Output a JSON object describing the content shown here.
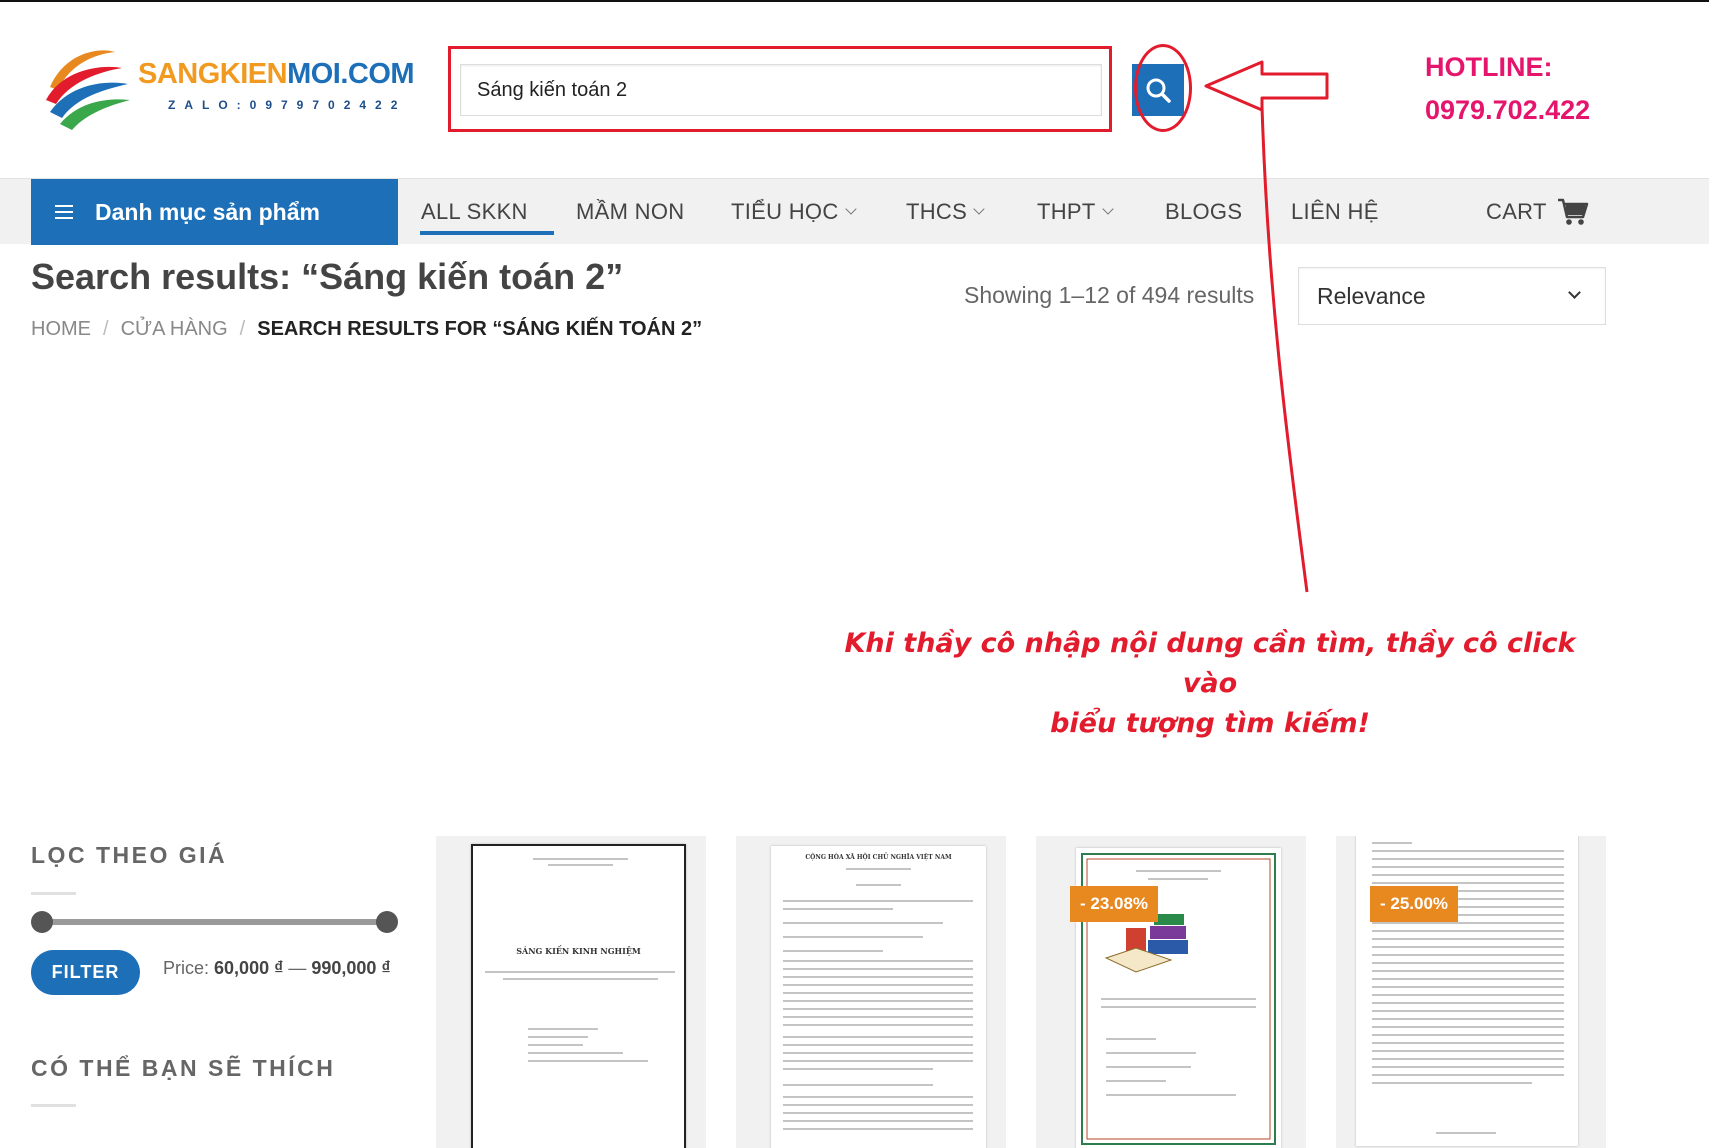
{
  "header": {
    "logo": {
      "word1": "SANGKIEN",
      "word2": "MOI.COM",
      "zalo": "ZALO:0979702422"
    },
    "search": {
      "value": "Sáng kiến toán 2",
      "placeholder": ""
    },
    "hotline_label": "HOTLINE:",
    "hotline_number": "0979.702.422"
  },
  "nav": {
    "category_button": "Danh mục sản phẩm",
    "items": [
      {
        "label": "ALL SKKN",
        "dropdown": false,
        "active": true
      },
      {
        "label": "MẦM NON",
        "dropdown": false
      },
      {
        "label": "TIỂU HỌC",
        "dropdown": true
      },
      {
        "label": "THCS",
        "dropdown": true
      },
      {
        "label": "THPT",
        "dropdown": true
      },
      {
        "label": "BLOGS",
        "dropdown": false
      },
      {
        "label": "LIÊN HỆ",
        "dropdown": false
      }
    ],
    "cart": "CART"
  },
  "page": {
    "title": "Search results: “Sáng kiến toán 2”",
    "breadcrumb": [
      "HOME",
      "CỬA HÀNG",
      "SEARCH RESULTS FOR “SÁNG KIẾN TOÁN 2”"
    ],
    "showing": "Showing 1–12 of 494 results",
    "sort": "Relevance"
  },
  "annotation": {
    "line1": "Khi thầy cô nhập nội dung cần tìm, thầy cô click vào",
    "line2": "biểu tượng tìm kiếm!",
    "color": "#e21b2d"
  },
  "sidebar": {
    "price_heading": "LỌC THEO GIÁ",
    "filter_button": "FILTER",
    "price_label": "Price:",
    "price_min": "60,000 ₫",
    "price_sep": "—",
    "price_max": "990,000 ₫",
    "suggest_heading": "CÓ THỂ BẠN SẼ THÍCH"
  },
  "products": [
    {
      "badge": "",
      "doc_heading": "SÁNG KIẾN KINH NGHIỆM"
    },
    {
      "badge": "",
      "doc_heading": "CỘNG HÒA XÃ HỘI CHỦ NGHĨA VIỆT NAM"
    },
    {
      "badge": "- 23.08%",
      "doc_heading": ""
    },
    {
      "badge": "- 25.00%",
      "doc_heading": ""
    }
  ],
  "colors": {
    "primary": "#1d6fb8",
    "hotline": "#e5156e",
    "badge": "#e8891f",
    "annotation": "#e21b2d"
  }
}
